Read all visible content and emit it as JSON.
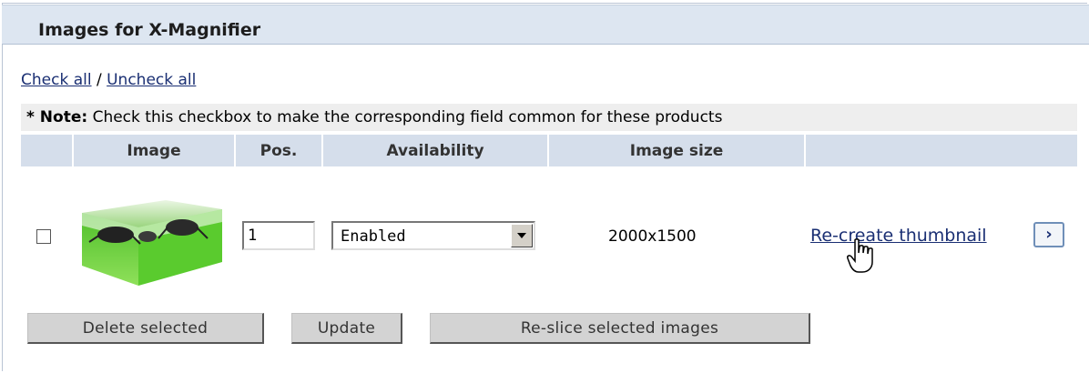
{
  "panel": {
    "title": "Images for X-Magnifier"
  },
  "links": {
    "check_all": "Check all",
    "separator": " / ",
    "uncheck_all": "Uncheck all"
  },
  "note": {
    "prefix": "* Note:",
    "text": " Check this checkbox to make the corresponding field common for these products"
  },
  "table": {
    "columns": [
      "",
      "Image",
      "Pos.",
      "Availability",
      "Image size",
      ""
    ],
    "rows": [
      {
        "checked": false,
        "image_icon": "green-glass-box-with-beetles",
        "position": "1",
        "availability": "Enabled",
        "image_size": "2000x1500",
        "action_label": "Re-create thumbnail",
        "action_go": "›"
      }
    ]
  },
  "buttons": {
    "delete": "Delete selected",
    "update": "Update",
    "reslice": "Re-slice selected images"
  },
  "colors": {
    "header_bg": "#dde6f1",
    "column_header_bg": "#d5deeb",
    "note_bg": "#eeeeee",
    "link": "#1a2f73",
    "button_bg": "#d3d3d3"
  }
}
